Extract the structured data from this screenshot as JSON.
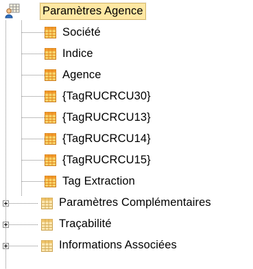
{
  "tree": {
    "root": {
      "label": "Paramètres Agence",
      "icon": "users-grid-icon",
      "selected": true
    },
    "children": [
      {
        "label": "Société",
        "icon": "table-icon"
      },
      {
        "label": "Indice",
        "icon": "table-icon"
      },
      {
        "label": "Agence",
        "icon": "table-icon"
      },
      {
        "label": "{TagRUCRCU30}",
        "icon": "table-icon"
      },
      {
        "label": "{TagRUCRCU13}",
        "icon": "table-icon"
      },
      {
        "label": "{TagRUCRCU14}",
        "icon": "table-icon"
      },
      {
        "label": "{TagRUCRCU15}",
        "icon": "table-icon"
      },
      {
        "label": "Tag Extraction",
        "icon": "table-icon"
      }
    ],
    "siblings": [
      {
        "label": "Paramètres Complémentaires",
        "icon": "grid-group-icon",
        "expandable": true
      },
      {
        "label": "Traçabilité",
        "icon": "grid-group-icon",
        "expandable": true
      },
      {
        "label": "Informations Associées",
        "icon": "grid-group-icon",
        "expandable": true
      }
    ]
  },
  "colors": {
    "selection_bg": "#ffe8a3",
    "table_icon_orange": "#f39a2b",
    "table_icon_yellow": "#f7d36a",
    "tree_line": "#808080"
  }
}
